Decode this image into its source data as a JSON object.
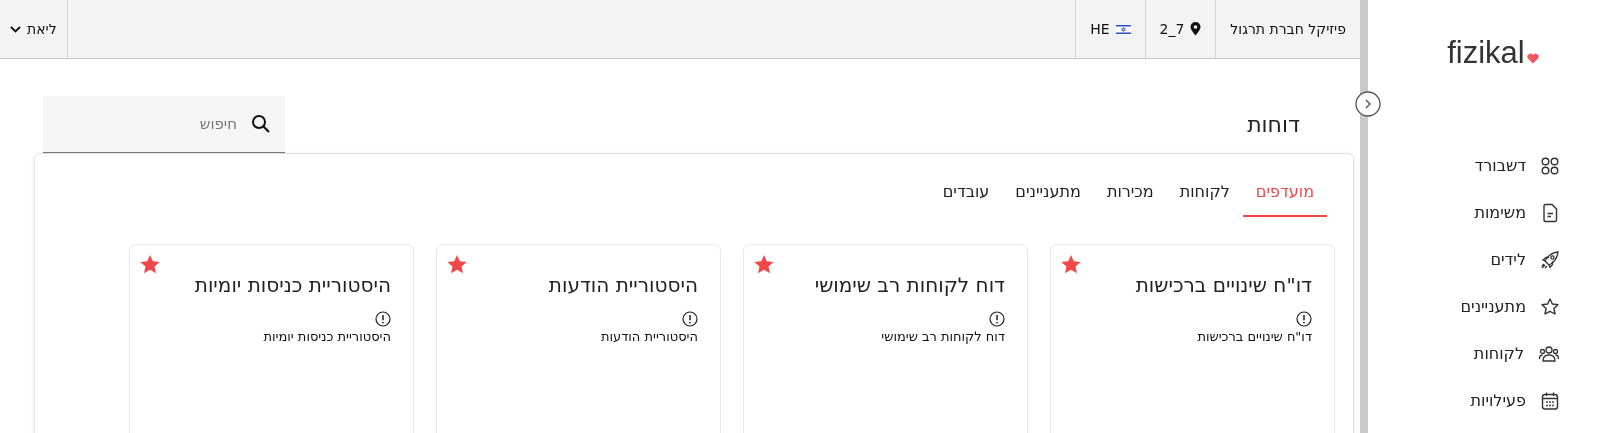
{
  "top_bar": {
    "company": "פיזיקל חברת תרגול",
    "branch": "7_2",
    "language": "HE",
    "user": "ליאת"
  },
  "sidebar": {
    "logo": "fizikal",
    "items": [
      {
        "label": "דשבורד",
        "selected": false
      },
      {
        "label": "משימות",
        "selected": false
      },
      {
        "label": "לידים",
        "selected": false
      },
      {
        "label": "מתעניינים",
        "selected": false
      },
      {
        "label": "לקוחות",
        "selected": false
      },
      {
        "label": "פעילויות",
        "selected": false
      }
    ]
  },
  "page": {
    "title": "דוחות",
    "search": {
      "placeholder": "חיפוש"
    }
  },
  "tabs": [
    {
      "label": "מועדפים",
      "selected": true
    },
    {
      "label": "לקוחות",
      "selected": false
    },
    {
      "label": "מכירות",
      "selected": false
    },
    {
      "label": "מתעניינים",
      "selected": false
    },
    {
      "label": "עובדים",
      "selected": false
    }
  ],
  "reports": [
    {
      "title": "דו\"ח שינויים ברכישות",
      "description": "דו\"ח שינויים ברכישות",
      "favorite": true
    },
    {
      "title": "דוח לקוחות רב שימושי",
      "description": "דוח לקוחות רב שימושי",
      "favorite": true
    },
    {
      "title": "היסטוריית הודעות",
      "description": "היסטוריית הודעות",
      "favorite": true
    },
    {
      "title": "היסטוריית כניסות יומיות",
      "description": "היסטוריית כניסות יומיות",
      "favorite": true
    }
  ]
}
